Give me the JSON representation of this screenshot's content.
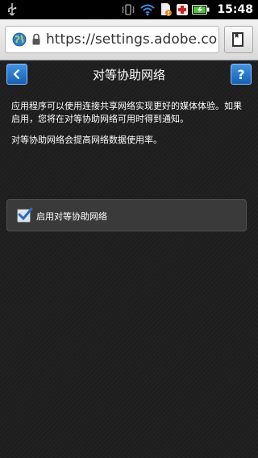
{
  "status_bar": {
    "time": "15:48",
    "icons": [
      "usb-icon",
      "vibrate-icon",
      "wifi-icon",
      "sd-card-icon",
      "battery-icon"
    ]
  },
  "browser": {
    "url": "https://settings.adobe.com/..."
  },
  "page": {
    "title": "对等协助网络",
    "help_label": "?",
    "description": "应用程序可以使用连接共享网络实现更好的媒体体验。如果启用，您将在对等协助网络可用时得到通知。",
    "note": "对等协助网络会提高网络数据使用率。",
    "option": {
      "label": "启用对等协助网络",
      "checked": true
    }
  },
  "colors": {
    "accent": "#1f6fc8",
    "background": "#1d1d1d",
    "panel": "#3a3a3a"
  }
}
